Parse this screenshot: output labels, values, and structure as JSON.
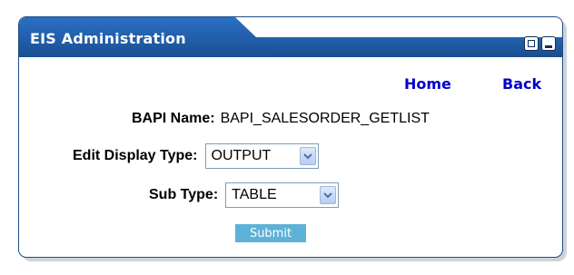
{
  "portlet": {
    "title": "EIS Administration",
    "maximize_icon": "maximize-icon",
    "minimize_icon": "minimize-icon"
  },
  "nav": {
    "home": "Home",
    "back": "Back"
  },
  "form": {
    "bapi_label": "BAPI Name:",
    "bapi_value": "BAPI_SALESORDER_GETLIST",
    "display_type_label": "Edit Display Type:",
    "display_type_value": "OUTPUT",
    "sub_type_label": "Sub Type:",
    "sub_type_value": "TABLE",
    "submit_label": "Submit"
  },
  "colors": {
    "title_bar": "#1f5aa6",
    "link": "#0000cc",
    "submit_bg": "#5db2d8"
  }
}
